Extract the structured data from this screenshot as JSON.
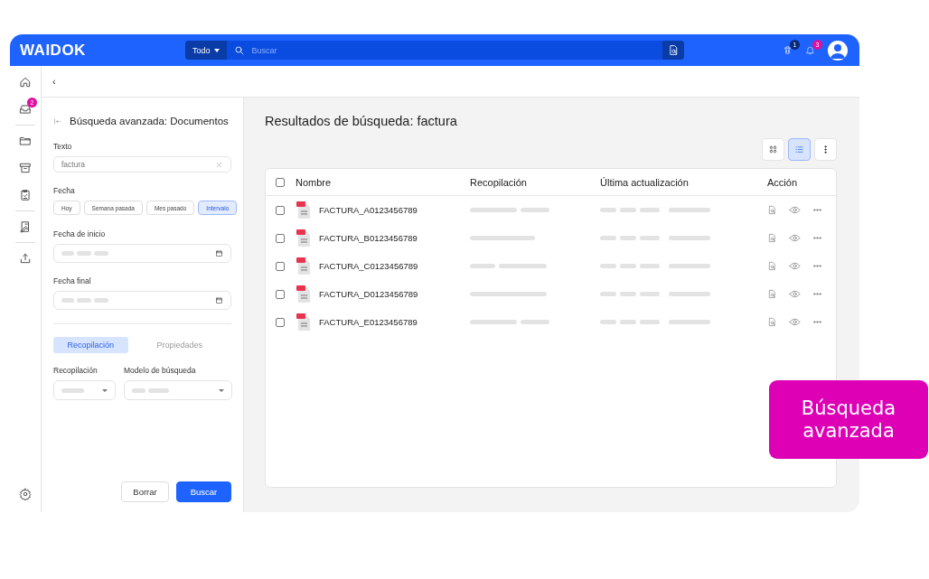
{
  "header": {
    "logo": "WAIDOK",
    "scope": "Todo",
    "search": {
      "placeholder": "Buscar"
    },
    "trash_badge": "1",
    "bell_badge": "3"
  },
  "nav": {
    "groups": [
      [
        {
          "kind": "home"
        },
        {
          "kind": "inbox",
          "badge": "2"
        }
      ],
      [
        {
          "kind": "folder"
        },
        {
          "kind": "archive"
        },
        {
          "kind": "clipboard"
        }
      ],
      [
        {
          "kind": "edit"
        }
      ],
      [
        {
          "kind": "upload"
        }
      ]
    ],
    "footer": {
      "kind": "settings"
    }
  },
  "breadcrumb": {
    "back": "‹"
  },
  "panel": {
    "title": "Búsqueda avanzada: Documentos",
    "text_field": {
      "label": "Texto",
      "value": "factura"
    },
    "date": {
      "label": "Fecha",
      "chips": [
        {
          "label": "Hoy",
          "selected": false
        },
        {
          "label": "Semana pasada",
          "selected": false
        },
        {
          "label": "Mes pasado",
          "selected": false
        },
        {
          "label": "Intervalo",
          "selected": true
        }
      ]
    },
    "start_date": {
      "label": "Fecha de inicio"
    },
    "end_date": {
      "label": "Fecha final"
    },
    "tabs": [
      {
        "label": "Recopilación",
        "selected": true
      },
      {
        "label": "Propiedades",
        "selected": false
      }
    ],
    "selects": [
      {
        "label": "Recopilación"
      },
      {
        "label": "Modelo de búsqueda"
      }
    ],
    "buttons": [
      {
        "label": "Borrar",
        "kind": "secondary"
      },
      {
        "label": "Buscar",
        "kind": "primary"
      }
    ]
  },
  "results": {
    "title": "Resultados de búsqueda: factura",
    "views": [
      {
        "kind": "grid",
        "selected": false
      },
      {
        "kind": "list",
        "selected": true
      },
      {
        "kind": "more",
        "selected": false
      }
    ],
    "table": {
      "select_all": {
        "checked": false
      },
      "columns": [
        "Nombre",
        "Recopilación",
        "Última actualización",
        "Acción"
      ],
      "rows": [
        {
          "name": "FACTURA_A0123456789",
          "checked": false
        },
        {
          "name": "FACTURA_B0123456789",
          "checked": false
        },
        {
          "name": "FACTURA_C0123456789",
          "checked": false
        },
        {
          "name": "FACTURA_D0123456789",
          "checked": false
        },
        {
          "name": "FACTURA_E0123456789",
          "checked": false
        }
      ]
    }
  },
  "callout": {
    "text": "Búsqueda avanzada"
  }
}
